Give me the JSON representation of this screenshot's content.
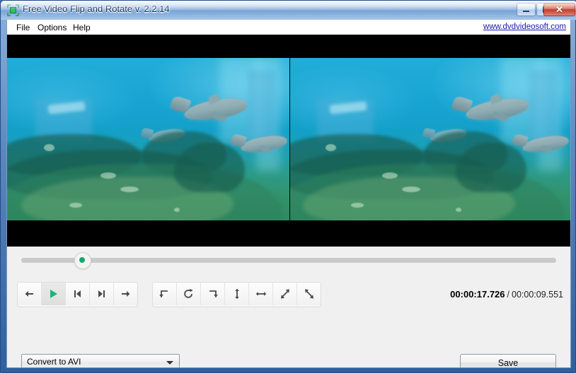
{
  "window": {
    "title": "Free Video Flip and Rotate v. 2.2.14",
    "icon": "crop-rotate-icon",
    "buttons": {
      "minimize": "minimize-icon",
      "maximize": "maximize-icon",
      "close": "✕"
    }
  },
  "menu": {
    "items": [
      {
        "label": "File",
        "name": "menu-file"
      },
      {
        "label": "Options",
        "name": "menu-options"
      },
      {
        "label": "Help",
        "name": "menu-help"
      }
    ],
    "site_link": "www.dvdvideosoft.com"
  },
  "preview": {
    "left_pane": "original-video-preview",
    "right_pane": "transformed-video-preview",
    "scene": "underwater reef with swimming dolphins"
  },
  "seek": {
    "position_percent": 11,
    "handle": "seek-handle"
  },
  "transport": {
    "buttons": [
      {
        "name": "step-back-button",
        "icon": "arrow-left-icon",
        "glyph": "←"
      },
      {
        "name": "play-button",
        "icon": "play-icon",
        "glyph": "▶"
      },
      {
        "name": "prev-frame-button",
        "icon": "skip-previous-icon",
        "glyph": "|◀"
      },
      {
        "name": "next-frame-button",
        "icon": "skip-next-icon",
        "glyph": "▶|"
      },
      {
        "name": "step-forward-button",
        "icon": "arrow-right-icon",
        "glyph": "→"
      }
    ]
  },
  "rotate": {
    "buttons": [
      {
        "name": "rotate-left-button",
        "icon": "rotate-counterclockwise-icon"
      },
      {
        "name": "rotate-180-button",
        "icon": "rotate-full-icon"
      },
      {
        "name": "rotate-right-button",
        "icon": "rotate-clockwise-icon"
      },
      {
        "name": "flip-vertical-button",
        "icon": "flip-vertical-icon"
      },
      {
        "name": "flip-horizontal-button",
        "icon": "flip-horizontal-icon"
      },
      {
        "name": "flip-diagonal-up-button",
        "icon": "flip-diagonal-up-icon"
      },
      {
        "name": "flip-diagonal-down-button",
        "icon": "flip-diagonal-down-icon"
      }
    ]
  },
  "time": {
    "current": "00:00:17.726",
    "separator": "/",
    "total": "00:00:09.551"
  },
  "output": {
    "format_label": "Convert to AVI",
    "save_label": "Save"
  },
  "colors": {
    "accent_green": "#15a86d",
    "link_blue": "#1a1aa8",
    "title_gradient_top": "#e3eefb",
    "title_gradient_bottom": "#a7c7ea",
    "close_red": "#bf3b2d",
    "panel_bg": "#f0f0f0"
  }
}
